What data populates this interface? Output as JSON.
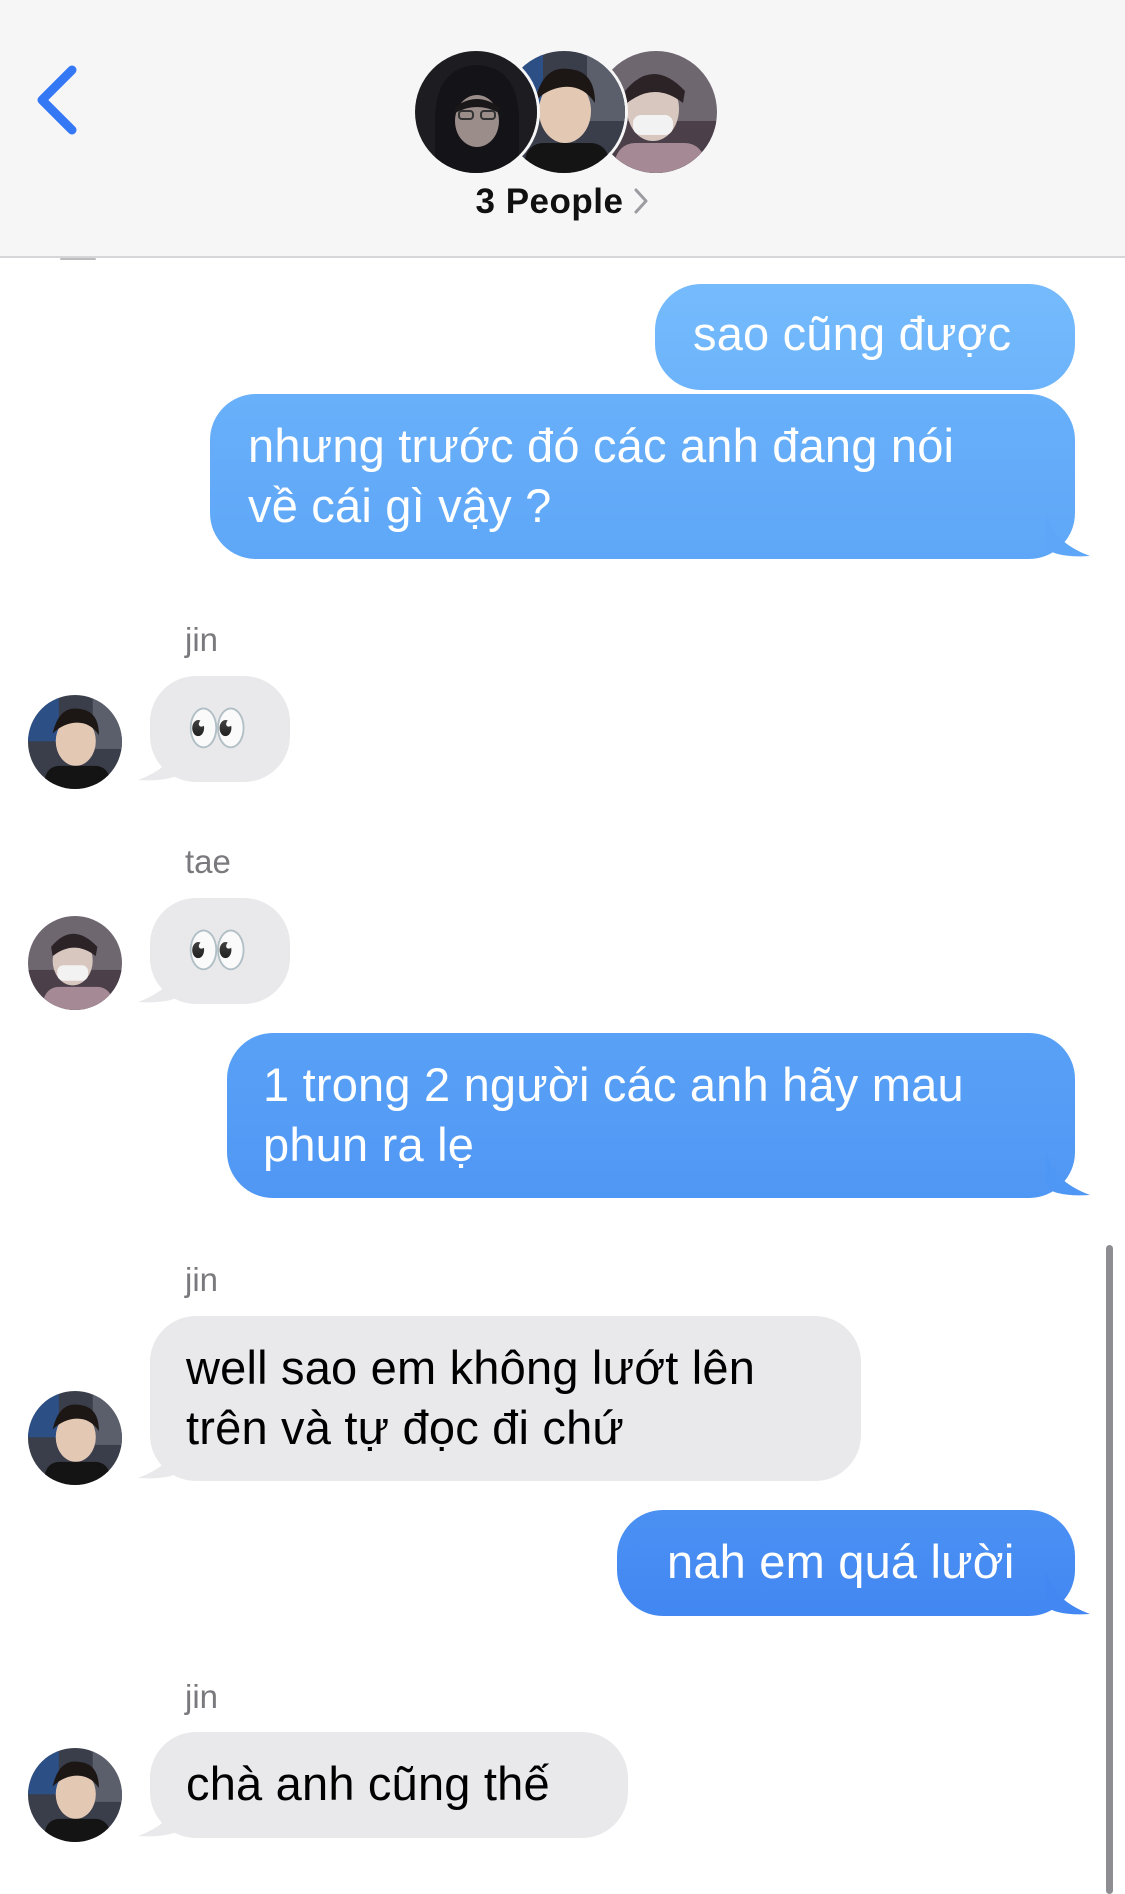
{
  "header": {
    "title": "3 People",
    "back_icon": "chevron-left-icon",
    "accent_color": "#3478f6"
  },
  "participants": [
    {
      "name": "dark-hoodie-person"
    },
    {
      "name": "jin"
    },
    {
      "name": "tae"
    }
  ],
  "messages": [
    {
      "direction": "outgoing",
      "text": "sao cũng được"
    },
    {
      "direction": "outgoing",
      "lines": [
        "nhưng trước đó các anh đang nói",
        "về cái gì vậy ?"
      ]
    },
    {
      "direction": "incoming",
      "sender": "jin",
      "text": "👀"
    },
    {
      "direction": "incoming",
      "sender": "tae",
      "text": "👀"
    },
    {
      "direction": "outgoing",
      "lines": [
        "1 trong 2 người các anh hãy mau",
        "phun ra lẹ"
      ]
    },
    {
      "direction": "incoming",
      "sender": "jin",
      "lines": [
        "well sao em không lướt lên",
        "trên và tự đọc đi chứ"
      ]
    },
    {
      "direction": "outgoing",
      "text": "nah em quá lười"
    },
    {
      "direction": "incoming",
      "sender": "jin",
      "text": "chà anh cũng thế"
    }
  ],
  "colors": {
    "outgoing_bubble_top": "#70b7fb",
    "outgoing_bubble_bottom": "#3f86f2",
    "incoming_bubble": "#e9e9eb",
    "sender_label": "#7a7a7e"
  }
}
